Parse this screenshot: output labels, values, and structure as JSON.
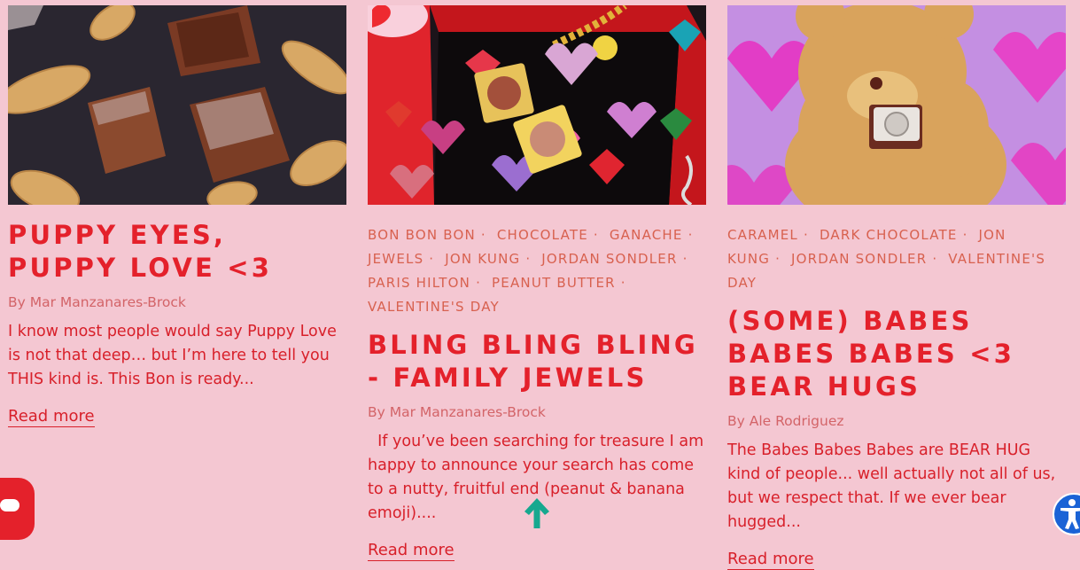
{
  "articles": [
    {
      "tags": [],
      "title": "PUPPY EYES, PUPPY LOVE <3",
      "byline": "By Mar Manzanares-Brock",
      "excerpt": "I know most people would say Puppy Love is not that deep… but I’m here to tell you THIS kind is. This Bon is ready...",
      "read_more": "Read more"
    },
    {
      "tags": [
        "BON BON BON",
        "CHOCOLATE",
        "GANACHE",
        "JEWELS",
        "JON KUNG",
        "JORDAN SONDLER",
        "PARIS HILTON",
        "PEANUT BUTTER",
        "VALENTINE'S DAY"
      ],
      "title": "BLING BLING BLING - FAMILY JEWELS",
      "byline": "By Mar Manzanares-Brock",
      "excerpt": "  If you’ve been searching for treasure I am happy to announce your search has come to a nutty, fruitful end (peanut & banana emoji)....",
      "read_more": "Read more"
    },
    {
      "tags": [
        "CARAMEL",
        "DARK CHOCOLATE",
        "JON KUNG",
        "JORDAN SONDLER",
        "VALENTINE'S DAY"
      ],
      "title": "(SOME) BABES BABES BABES <3 BEAR HUGS",
      "byline": "By Ale Rodriguez",
      "excerpt": "The Babes Babes Babes are BEAR HUG kind of people... well actually not all of us, but we respect that. If we ever bear hugged...",
      "read_more": "Read more"
    }
  ],
  "colors": {
    "background": "#f4c7d2",
    "title": "#e4212b",
    "tag": "#d8614f",
    "byline": "#d36468",
    "scroll_arrow": "#16a88f",
    "accessibility": "#1a63d6"
  },
  "icons": {
    "scroll_top": "up-arrow-icon",
    "chat": "chat-icon",
    "accessibility": "accessibility-icon"
  }
}
